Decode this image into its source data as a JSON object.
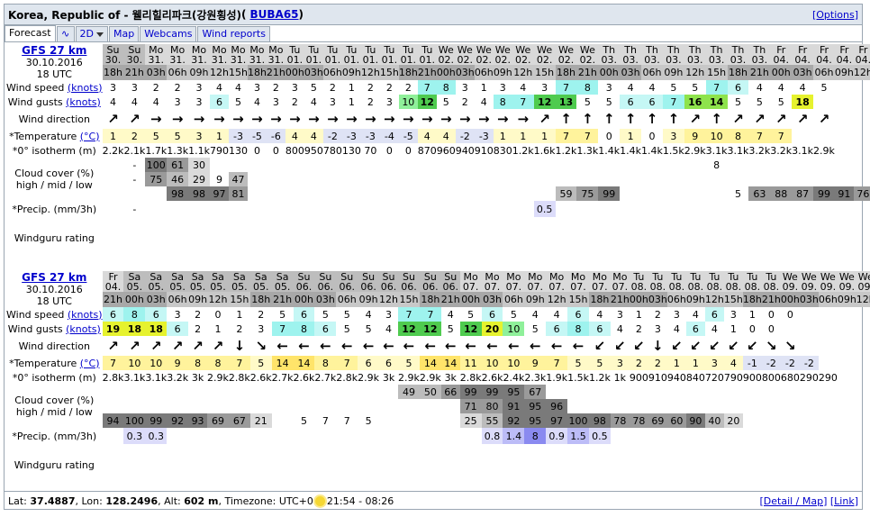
{
  "header": {
    "location": "Korea, Republic of - 웰리힐리파크(강원횡성)",
    "station": "BUBA65",
    "options": "[Options]"
  },
  "tabs": [
    {
      "label": "Forecast"
    },
    {
      "label": "2D"
    },
    {
      "label": "Map"
    },
    {
      "label": "Webcams"
    },
    {
      "label": "Wind reports"
    }
  ],
  "labels": {
    "wind_speed": "Wind speed",
    "wind_gusts": "Wind gusts",
    "knots": "(knots)",
    "wind_direction": "Wind direction",
    "temperature": "*Temperature",
    "celsius": "(°C)",
    "isotherm": "*0° isotherm (m)",
    "cloud1": "Cloud cover (%)",
    "cloud2": "high / mid / low",
    "precip": "*Precip. (mm/3h)",
    "rating": "Windguru rating"
  },
  "blocks": [
    {
      "model": "GFS 27 km",
      "date": "30.10.2016",
      "utc": "18 UTC",
      "days": [
        "Su",
        "Su",
        "Mo",
        "Mo",
        "Mo",
        "Mo",
        "Mo",
        "Mo",
        "Mo",
        "Tu",
        "Tu",
        "Tu",
        "Tu",
        "Tu",
        "Tu",
        "Tu",
        "Tu",
        "We",
        "We",
        "We",
        "We",
        "We",
        "We",
        "We",
        "We",
        "Th",
        "Th",
        "Th",
        "Th",
        "Th",
        "Th",
        "Th",
        "Th",
        "Fr",
        "Fr",
        "Fr",
        "Fr",
        "Fr"
      ],
      "dates": [
        "30.",
        "30.",
        "31.",
        "31.",
        "31.",
        "31.",
        "31.",
        "31.",
        "31.",
        "01.",
        "01.",
        "01.",
        "01.",
        "01.",
        "01.",
        "01.",
        "01.",
        "02.",
        "02.",
        "02.",
        "02.",
        "02.",
        "02.",
        "02.",
        "02.",
        "03.",
        "03.",
        "03.",
        "03.",
        "03.",
        "03.",
        "03.",
        "03.",
        "04.",
        "04.",
        "04.",
        "04.",
        "04."
      ],
      "hours": [
        "18h",
        "21h",
        "03h",
        "06h",
        "09h",
        "12h",
        "15h",
        "18h",
        "21h",
        "00h",
        "03h",
        "06h",
        "09h",
        "12h",
        "15h",
        "18h",
        "21h",
        "00h",
        "03h",
        "06h",
        "09h",
        "12h",
        "15h",
        "18h",
        "21h",
        "00h",
        "03h",
        "06h",
        "09h",
        "12h",
        "15h",
        "18h",
        "21h",
        "00h",
        "03h",
        "06h",
        "09h",
        "12h"
      ],
      "speed": [
        "3",
        "3",
        "2",
        "2",
        "3",
        "4",
        "4",
        "3",
        "2",
        "3",
        "5",
        "2",
        "1",
        "2",
        "2",
        "2",
        "7",
        "8",
        "3",
        "1",
        "3",
        "4",
        "3",
        "7",
        "8",
        "3",
        "4",
        "4",
        "5",
        "5",
        "7",
        "6",
        "4",
        "4",
        "4",
        "5"
      ],
      "gusts": [
        "4",
        "4",
        "4",
        "3",
        "3",
        "6",
        "5",
        "4",
        "3",
        "2",
        "4",
        "3",
        "1",
        "2",
        "3",
        "10",
        "12",
        "5",
        "2",
        "4",
        "8",
        "7",
        "12",
        "13",
        "5",
        "5",
        "6",
        "6",
        "7",
        "16",
        "14",
        "5",
        "5",
        "5",
        "18"
      ],
      "dir": [
        "↗",
        "↗",
        "→",
        "→",
        "→",
        "→",
        "→",
        "→",
        "→",
        "→",
        "→",
        "→",
        "→",
        "→",
        "→",
        "→",
        "→",
        "→",
        "→",
        "→",
        "→",
        "→",
        "↗",
        "↑",
        "↑",
        "↑",
        "↑",
        "↑",
        "↑",
        "↗",
        "↑",
        "↗",
        "↗",
        "↗",
        "↗",
        "↗"
      ],
      "temp": [
        "1",
        "2",
        "5",
        "5",
        "3",
        "1",
        "-3",
        "-5",
        "-6",
        "4",
        "4",
        "-2",
        "-3",
        "-3",
        "-4",
        "-5",
        "4",
        "4",
        "-2",
        "-3",
        "1",
        "1",
        "1",
        "7",
        "7",
        "0",
        "1",
        "0",
        "3",
        "9",
        "10",
        "8",
        "7",
        "7"
      ],
      "iso": [
        "2.2k",
        "2.1k",
        "1.7k",
        "1.3k",
        "1.1k",
        "790",
        "130",
        "0",
        "0",
        "800",
        "950",
        "780",
        "130",
        "70",
        "0",
        "0",
        "870",
        "960",
        "940",
        "910",
        "830",
        "1.2k",
        "1.6k",
        "1.2k",
        "1.3k",
        "1.4k",
        "1.4k",
        "1.4k",
        "1.5k",
        "2.9k",
        "3.1k",
        "3.1k",
        "3.2k",
        "3.2k",
        "3.1k",
        "2.9k"
      ],
      "cloudH": [
        "",
        "-",
        "100",
        "61",
        "30",
        "",
        "",
        "",
        "",
        "",
        "",
        "",
        "",
        "",
        "",
        "",
        "",
        "",
        "",
        "",
        "",
        "",
        "",
        "",
        "",
        "",
        "",
        "",
        "",
        "",
        "8",
        "",
        "",
        "",
        "",
        "",
        ""
      ],
      "cloudM": [
        "",
        "-",
        "75",
        "46",
        "29",
        "9",
        "47",
        "",
        "",
        "",
        "",
        "",
        "",
        "",
        "",
        "",
        "",
        "",
        "",
        "",
        "",
        "",
        "",
        "",
        "",
        "",
        "",
        "",
        "",
        "",
        "",
        "",
        "",
        "",
        "",
        "",
        ""
      ],
      "cloudL": [
        "",
        "",
        "",
        "98",
        "98",
        "97",
        "81",
        "",
        "",
        "",
        "",
        "",
        "",
        "",
        "",
        "",
        "",
        "",
        "",
        "",
        "",
        "",
        "",
        "59",
        "75",
        "99",
        "",
        "",
        "",
        "",
        "",
        "5",
        "63",
        "88",
        "87",
        "99",
        "91",
        "76",
        "87"
      ],
      "precip": [
        "",
        "-",
        "",
        "",
        "",
        "",
        "",
        "",
        "",
        "",
        "",
        "",
        "",
        "",
        "",
        "",
        "",
        "",
        "",
        "",
        "",
        "",
        "0.5",
        "",
        "",
        "",
        "",
        "",
        "",
        "",
        "",
        "",
        "",
        "",
        "",
        "",
        "",
        ""
      ]
    },
    {
      "model": "GFS 27 km",
      "date": "30.10.2016",
      "utc": "18 UTC",
      "days": [
        "Fr",
        "Sa",
        "Sa",
        "Sa",
        "Sa",
        "Sa",
        "Sa",
        "Sa",
        "Sa",
        "Su",
        "Su",
        "Su",
        "Su",
        "Su",
        "Su",
        "Su",
        "Su",
        "Mo",
        "Mo",
        "Mo",
        "Mo",
        "Mo",
        "Mo",
        "Mo",
        "Mo",
        "Tu",
        "Tu",
        "Tu",
        "Tu",
        "Tu",
        "Tu",
        "Tu",
        "Tu",
        "We",
        "We",
        "We",
        "We",
        "We"
      ],
      "dates": [
        "04.",
        "05.",
        "05.",
        "05.",
        "05.",
        "05.",
        "05.",
        "05.",
        "05.",
        "06.",
        "06.",
        "06.",
        "06.",
        "06.",
        "06.",
        "06.",
        "06.",
        "07.",
        "07.",
        "07.",
        "07.",
        "07.",
        "07.",
        "07.",
        "07.",
        "08.",
        "08.",
        "08.",
        "08.",
        "08.",
        "08.",
        "08.",
        "08.",
        "09.",
        "09.",
        "09.",
        "09.",
        "09."
      ],
      "hours": [
        "21h",
        "00h",
        "03h",
        "06h",
        "09h",
        "12h",
        "15h",
        "18h",
        "21h",
        "00h",
        "03h",
        "06h",
        "09h",
        "12h",
        "15h",
        "18h",
        "21h",
        "00h",
        "03h",
        "06h",
        "09h",
        "12h",
        "15h",
        "18h",
        "21h",
        "00h",
        "03h",
        "06h",
        "09h",
        "12h",
        "15h",
        "18h",
        "21h",
        "00h",
        "03h",
        "06h",
        "09h",
        "12h"
      ],
      "speed": [
        "6",
        "8",
        "6",
        "3",
        "2",
        "0",
        "1",
        "2",
        "5",
        "6",
        "5",
        "5",
        "4",
        "3",
        "7",
        "7",
        "4",
        "5",
        "6",
        "5",
        "4",
        "4",
        "6",
        "4",
        "3",
        "1",
        "2",
        "3",
        "4",
        "6",
        "3",
        "1",
        "0",
        "0"
      ],
      "gusts": [
        "19",
        "18",
        "18",
        "6",
        "2",
        "1",
        "2",
        "3",
        "7",
        "8",
        "6",
        "5",
        "5",
        "4",
        "12",
        "12",
        "5",
        "12",
        "20",
        "10",
        "5",
        "6",
        "8",
        "6",
        "4",
        "2",
        "3",
        "4",
        "6",
        "4",
        "1",
        "0",
        "0"
      ],
      "dir": [
        "↗",
        "↗",
        "↗",
        "↗",
        "↗",
        "↗",
        "↓",
        "↘",
        "←",
        "←",
        "←",
        "←",
        "←",
        "←",
        "←",
        "←",
        "←",
        "←",
        "←",
        "←",
        "←",
        "←",
        "←",
        "↙",
        "↙",
        "↙",
        "↓",
        "↙",
        "↙",
        "↙",
        "↙",
        "↙",
        "↘",
        "↘"
      ],
      "temp": [
        "7",
        "10",
        "10",
        "9",
        "8",
        "8",
        "7",
        "5",
        "14",
        "14",
        "8",
        "7",
        "6",
        "6",
        "5",
        "14",
        "14",
        "11",
        "10",
        "10",
        "9",
        "7",
        "5",
        "5",
        "3",
        "2",
        "2",
        "1",
        "1",
        "3",
        "4",
        "-1",
        "-2",
        "-2",
        "-2"
      ],
      "iso": [
        "2.8k",
        "3.1k",
        "3.1k",
        "3.2k",
        "3k",
        "2.9k",
        "2.8k",
        "2.6k",
        "2.7k",
        "2.6k",
        "2.7k",
        "2.8k",
        "2.9k",
        "3k",
        "2.9k",
        "2.9k",
        "3k",
        "2.8k",
        "2.6k",
        "2.4k",
        "2.3k",
        "1.9k",
        "1.5k",
        "1.2k",
        "1k",
        "900",
        "910",
        "940",
        "840",
        "720",
        "790",
        "900",
        "800",
        "680",
        "290",
        "290"
      ],
      "cloudH": [
        "",
        "",
        "",
        "",
        "",
        "",
        "",
        "",
        "",
        "",
        "",
        "",
        "",
        "",
        "49",
        "50",
        "66",
        "99",
        "99",
        "95",
        "67",
        "",
        "",
        "",
        "",
        "",
        "",
        "",
        "",
        "",
        "",
        "",
        "",
        "",
        ""
      ],
      "cloudM": [
        "",
        "",
        "",
        "",
        "",
        "",
        "",
        "",
        "",
        "",
        "",
        "",
        "",
        "",
        "",
        "",
        "",
        "71",
        "80",
        "91",
        "95",
        "96",
        "",
        "",
        "",
        "",
        "",
        "",
        "",
        "",
        "",
        "",
        "",
        "",
        ""
      ],
      "cloudL": [
        "94",
        "100",
        "99",
        "92",
        "93",
        "69",
        "67",
        "21",
        "",
        "5",
        "7",
        "7",
        "5",
        "",
        "",
        "",
        "",
        "25",
        "55",
        "92",
        "95",
        "97",
        "100",
        "98",
        "78",
        "78",
        "69",
        "60",
        "90",
        "40",
        "20",
        "",
        "",
        "",
        ""
      ],
      "precip": [
        "",
        "0.3",
        "0.3",
        "",
        "",
        "",
        "",
        "",
        "",
        "",
        "",
        "",
        "",
        "",
        "",
        "",
        "",
        "",
        "0.8",
        "1.4",
        "8",
        "0.9",
        "1.5",
        "0.5",
        "",
        "",
        "",
        "",
        "",
        "",
        "",
        "",
        "",
        "",
        ""
      ]
    }
  ],
  "footer": {
    "lat_label": "Lat:",
    "lat": "37.4887",
    "lon_label": "Lon:",
    "lon": "128.2496",
    "alt_label": "Alt:",
    "alt": "602 m",
    "tz_label": "Timezone:",
    "tz": "UTC+0",
    "sun": "21:54 - 08:26",
    "links": "[Detail / Map]",
    "link2": "[Link]"
  }
}
